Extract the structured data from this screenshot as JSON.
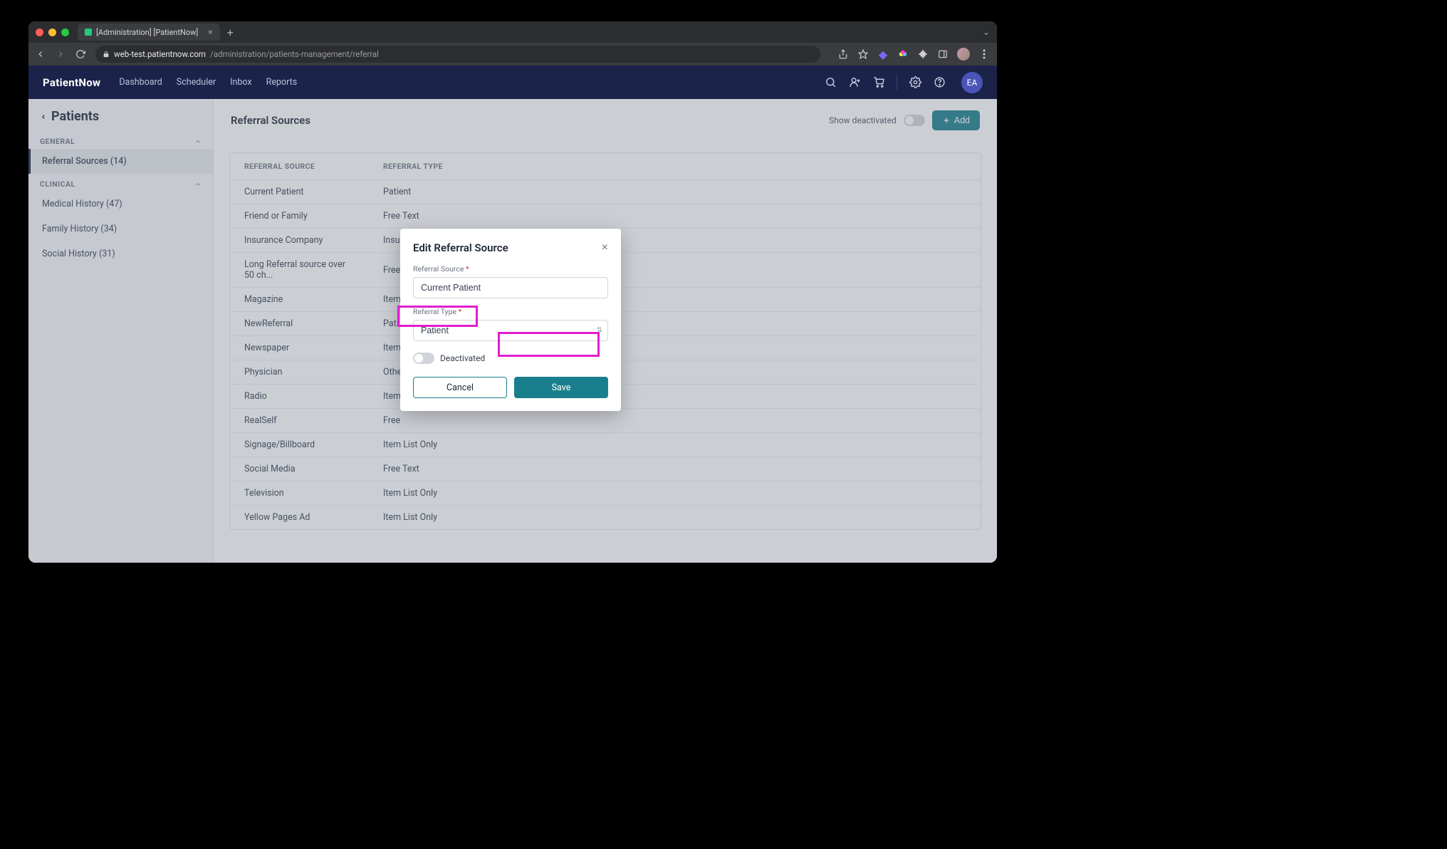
{
  "browser": {
    "tab_title": "[Administration] [PatientNow]",
    "url_host": "web-test.patientnow.com",
    "url_path": "/administration/patients-management/referral"
  },
  "header": {
    "brand": "PatientNow",
    "nav": [
      "Dashboard",
      "Scheduler",
      "Inbox",
      "Reports"
    ],
    "avatar": "EA"
  },
  "sidebar": {
    "title": "Patients",
    "sections": [
      {
        "label": "GENERAL",
        "items": [
          {
            "label": "Referral Sources (14)",
            "active": true
          }
        ]
      },
      {
        "label": "CLINICAL",
        "items": [
          {
            "label": "Medical History (47)"
          },
          {
            "label": "Family History (34)"
          },
          {
            "label": "Social History (31)"
          }
        ]
      }
    ]
  },
  "main": {
    "title": "Referral Sources",
    "show_deactivated_label": "Show deactivated",
    "add_label": "Add",
    "columns": [
      "REFERRAL SOURCE",
      "REFERRAL TYPE"
    ],
    "rows": [
      {
        "source": "Current Patient",
        "type": "Patient"
      },
      {
        "source": "Friend or Family",
        "type": "Free Text"
      },
      {
        "source": "Insurance Company",
        "type": "Insu"
      },
      {
        "source": "Long Referral source over 50 ch...",
        "type": "Free"
      },
      {
        "source": "Magazine",
        "type": "Item"
      },
      {
        "source": "NewReferral",
        "type": "Pati"
      },
      {
        "source": "Newspaper",
        "type": "Item"
      },
      {
        "source": "Physician",
        "type": "Othe"
      },
      {
        "source": "Radio",
        "type": "Item"
      },
      {
        "source": "RealSelf",
        "type": "Free"
      },
      {
        "source": "Signage/Billboard",
        "type": "Item List Only"
      },
      {
        "source": "Social Media",
        "type": "Free Text"
      },
      {
        "source": "Television",
        "type": "Item List Only"
      },
      {
        "source": "Yellow Pages Ad",
        "type": "Item List Only"
      }
    ]
  },
  "modal": {
    "title": "Edit Referral Source",
    "source_label": "Referral Source",
    "source_value": "Current Patient",
    "type_label": "Referral Type",
    "type_value": "Patient",
    "deactivated_label": "Deactivated",
    "cancel": "Cancel",
    "save": "Save"
  }
}
